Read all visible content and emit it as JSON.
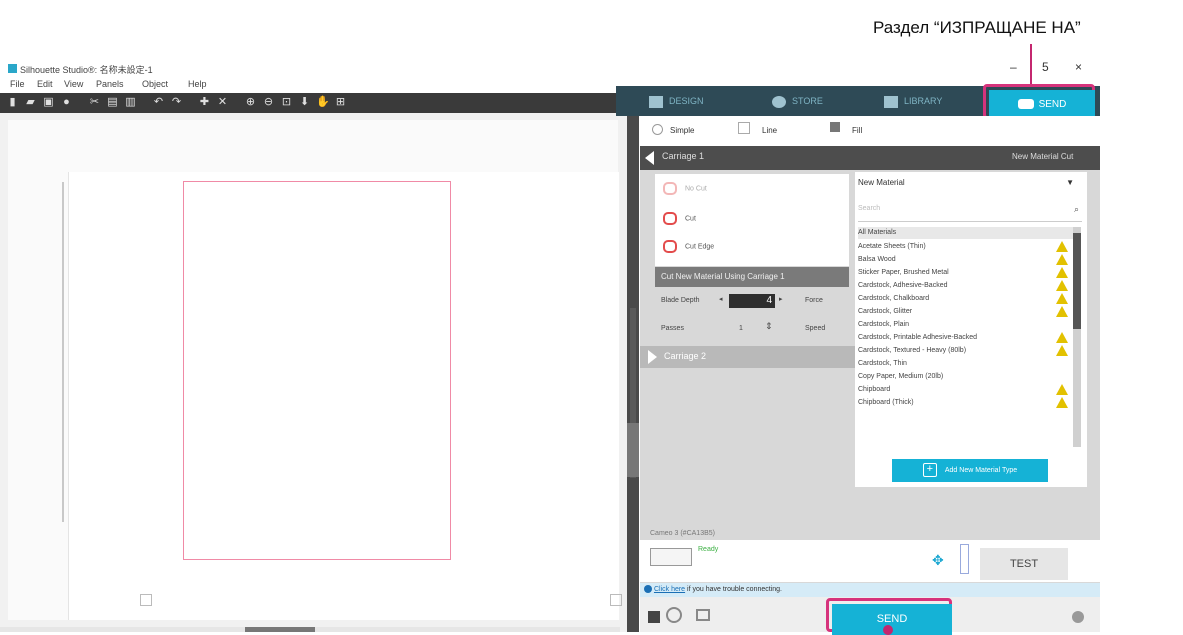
{
  "annotation": {
    "label": "Раздел “ИЗПРАЩАНЕ НА”",
    "color": "#d6337c"
  },
  "window": {
    "title": "Silhouette Studio®: 名称未設定-1",
    "menu": [
      "File",
      "Edit",
      "View",
      "Panels",
      "Object",
      "Help"
    ],
    "controls": {
      "minimize": "–",
      "maximize": "5",
      "close": "×"
    }
  },
  "top_tabs": [
    {
      "label": "DESIGN",
      "icon": "design-icon"
    },
    {
      "label": "STORE",
      "icon": "store-icon"
    },
    {
      "label": "LIBRARY",
      "icon": "library-icon"
    },
    {
      "label": "SEND",
      "icon": "cutter-icon",
      "active": true
    }
  ],
  "send_panel": {
    "modes": [
      "Simple",
      "Line",
      "Fill"
    ],
    "carriage1": {
      "label": "Carriage 1",
      "right_label": "New Material Cut"
    },
    "carriage2": {
      "label": "Carriage 2"
    },
    "cut_options": [
      "No Cut",
      "Cut",
      "Cut Edge"
    ],
    "cut_with": "Cut New Material Using Carriage 1",
    "blade_depth_label": "Blade Depth",
    "blade_depth_value": "4",
    "force_label": "Force",
    "passes_label": "Passes",
    "passes_value": "1",
    "speed_label": "Speed",
    "material": {
      "selected": "New Material",
      "search_placeholder": "Search",
      "items": [
        {
          "name": "All Materials",
          "header": true,
          "warn": false
        },
        {
          "name": "Acetate Sheets (Thin)",
          "warn": true
        },
        {
          "name": "Balsa Wood",
          "warn": true
        },
        {
          "name": "Sticker Paper, Brushed Metal",
          "warn": true
        },
        {
          "name": "Cardstock, Adhesive-Backed",
          "warn": true
        },
        {
          "name": "Cardstock, Chalkboard",
          "warn": true
        },
        {
          "name": "Cardstock, Glitter",
          "warn": true
        },
        {
          "name": "Cardstock, Plain",
          "warn": false
        },
        {
          "name": "Cardstock, Printable Adhesive-Backed",
          "warn": true
        },
        {
          "name": "Cardstock, Textured - Heavy (80lb)",
          "warn": true
        },
        {
          "name": "Cardstock, Thin",
          "warn": false
        },
        {
          "name": "Copy Paper, Medium (20lb)",
          "warn": false
        },
        {
          "name": "Chipboard",
          "warn": true
        },
        {
          "name": "Chipboard (Thick)",
          "warn": true
        }
      ],
      "add_button": "Add New Material Type"
    },
    "connection_label": "Cameo 3 (#CA13B5)",
    "status": "Ready",
    "test_button": "TEST",
    "info_link": "Click here",
    "info_text": " if you have trouble connecting.",
    "send_button": "SEND"
  }
}
